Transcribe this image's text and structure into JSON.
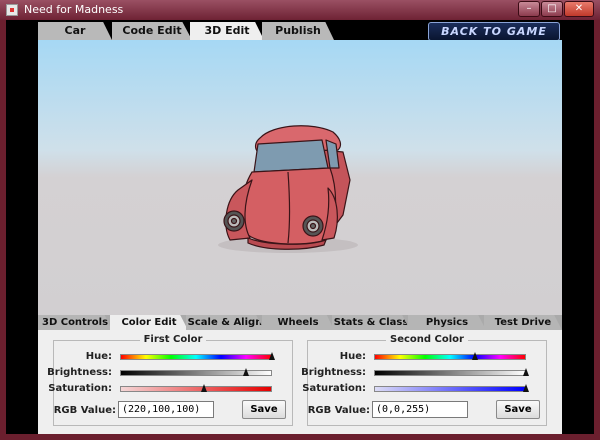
{
  "window": {
    "title": "Need for Madness",
    "minimize": "–",
    "maximize": "□",
    "close": "✕"
  },
  "main_tabs": [
    {
      "label": "Car",
      "active": false
    },
    {
      "label": "Code Edit",
      "active": false
    },
    {
      "label": "3D Edit",
      "active": true
    },
    {
      "label": "Publish",
      "active": false
    }
  ],
  "back_button": "BACK TO GAME",
  "sub_tabs": [
    {
      "label": "3D Controls",
      "active": false
    },
    {
      "label": "Color Edit",
      "active": true
    },
    {
      "label": "Scale & Align",
      "active": false
    },
    {
      "label": "Wheels",
      "active": false
    },
    {
      "label": "Stats & Class",
      "active": false
    },
    {
      "label": "Physics",
      "active": false
    },
    {
      "label": "Test Drive",
      "active": false
    }
  ],
  "first_color": {
    "title": "First Color",
    "hue_label": "Hue:",
    "brightness_label": "Brightness:",
    "saturation_label": "Saturation:",
    "rgb_label": "RGB Value:",
    "rgb_value": "(220,100,100)",
    "save_label": "Save",
    "hue": 1.0,
    "brightness": 0.86,
    "saturation": 0.55,
    "color": "#dc6464"
  },
  "second_color": {
    "title": "Second Color",
    "hue_label": "Hue:",
    "brightness_label": "Brightness:",
    "saturation_label": "Saturation:",
    "rgb_label": "RGB Value:",
    "rgb_value": "(0,0,255)",
    "save_label": "Save",
    "hue": 0.67,
    "brightness": 1.0,
    "saturation": 1.0,
    "color": "#0000ff"
  },
  "colors": {
    "car_body": "#d45f63",
    "car_outline": "#3a1418",
    "glass": "#7e9bb0",
    "window_frame": "#6b1f2e"
  }
}
